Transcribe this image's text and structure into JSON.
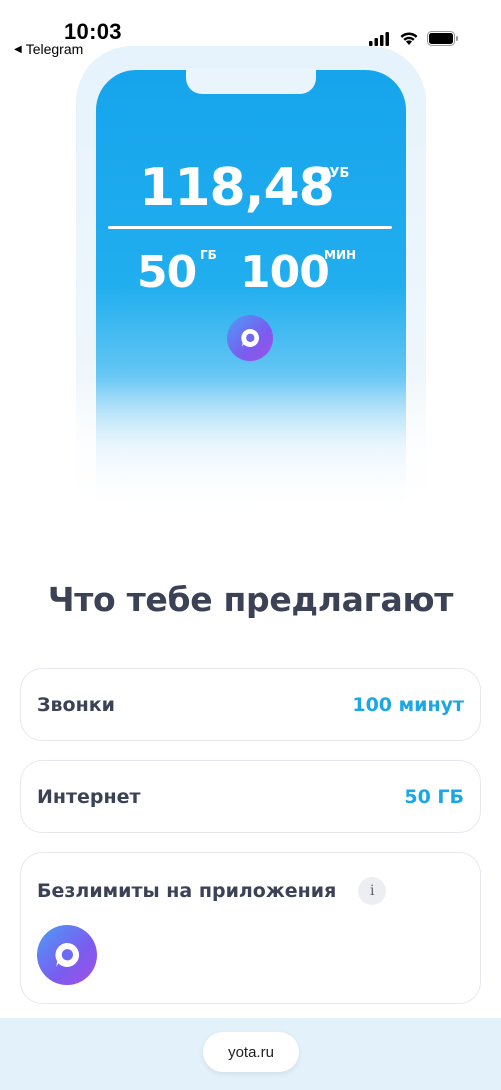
{
  "status_bar": {
    "time": "10:03",
    "back_app": "Telegram",
    "icons": [
      "cellular-signal-icon",
      "wifi-icon",
      "battery-icon"
    ]
  },
  "hero": {
    "balance_amount": "118,48",
    "balance_unit": "РУБ",
    "data_amount": "50",
    "data_unit": "ГБ",
    "minutes_amount": "100",
    "minutes_unit": "МИН",
    "app_icon": "chat-app-icon"
  },
  "section": {
    "title": "Что тебе предлагают"
  },
  "offers": [
    {
      "label": "Звонки",
      "value": "100 минут"
    },
    {
      "label": "Интернет",
      "value": "50 ГБ"
    }
  ],
  "unlimited": {
    "label": "Безлимиты на приложения",
    "info_icon": "info-icon",
    "app_icon": "chat-app-icon"
  },
  "browser": {
    "url": "yota.ru"
  },
  "colors": {
    "accent": "#1ba6e6",
    "hero_blue": "#16a4ec",
    "text": "#3b4256"
  }
}
